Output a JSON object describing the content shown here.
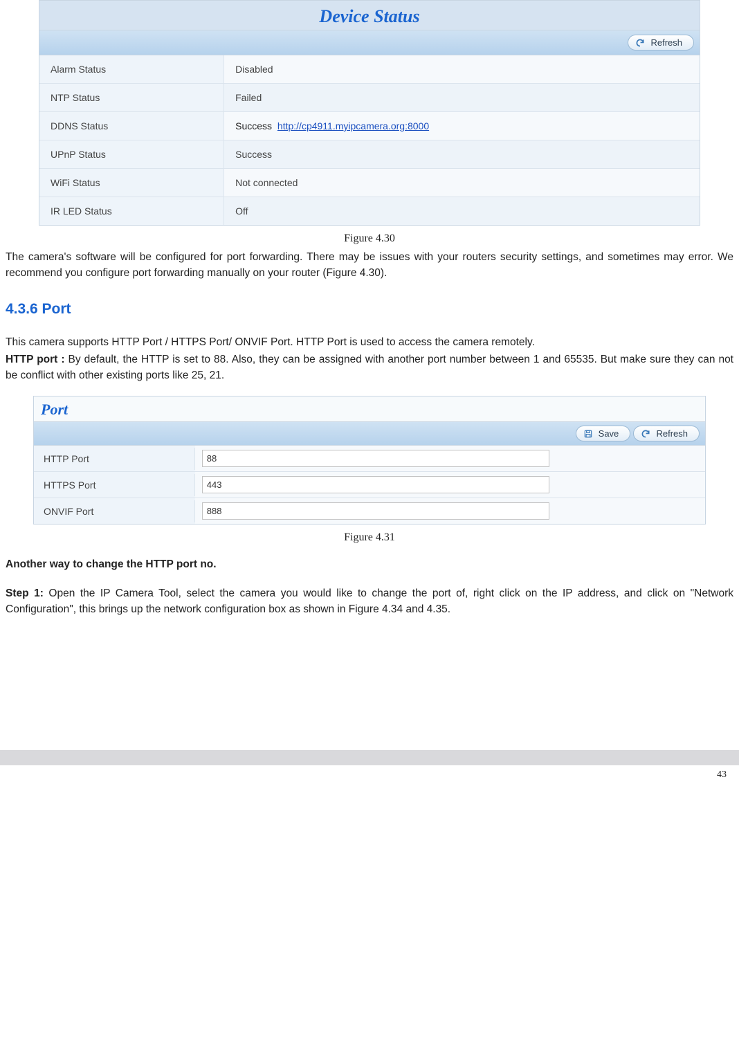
{
  "device_status": {
    "title": "Device Status",
    "refresh_label": "Refresh",
    "rows": [
      {
        "label": "Alarm Status",
        "value": "Disabled"
      },
      {
        "label": "NTP Status",
        "value": "Failed"
      },
      {
        "label": "DDNS Status",
        "value_prefix": "Success",
        "link": "http://cp4911.myipcamera.org:8000"
      },
      {
        "label": "UPnP Status",
        "value": "Success"
      },
      {
        "label": "WiFi Status",
        "value": "Not connected"
      },
      {
        "label": "IR LED Status",
        "value": "Off"
      }
    ]
  },
  "captions": {
    "fig430": "Figure 4.30",
    "fig431": "Figure 4.31"
  },
  "text": {
    "p1": "The camera's software will be configured for port forwarding. There may be issues with your routers security settings, and sometimes may error. We recommend you configure port forwarding manually on your router (Figure 4.30).",
    "sect_436": "4.3.6 Port",
    "p2": "This camera supports HTTP Port / HTTPS Port/ ONVIF Port. HTTP Port is used to access the camera remotely.",
    "p3_label": "HTTP port :",
    "p3_rest": " By default, the HTTP is set to 88. Also, they can be assigned with another port number between 1 and 65535. But make sure they can not be conflict with other existing ports like 25, 21.",
    "p4": "Another way to change the HTTP port no.",
    "p5_label": "Step 1:",
    "p5_rest": " Open the IP Camera Tool, select the camera you would like to change the port of, right click on the IP address, and click on \"Network Configuration\", this brings up the network configuration box as shown in Figure 4.34 and 4.35."
  },
  "port_panel": {
    "title": "Port",
    "save_label": "Save",
    "refresh_label": "Refresh",
    "rows": [
      {
        "label": "HTTP Port",
        "value": "88"
      },
      {
        "label": "HTTPS Port",
        "value": "443"
      },
      {
        "label": "ONVIF Port",
        "value": "888"
      }
    ]
  },
  "page_number": "43"
}
